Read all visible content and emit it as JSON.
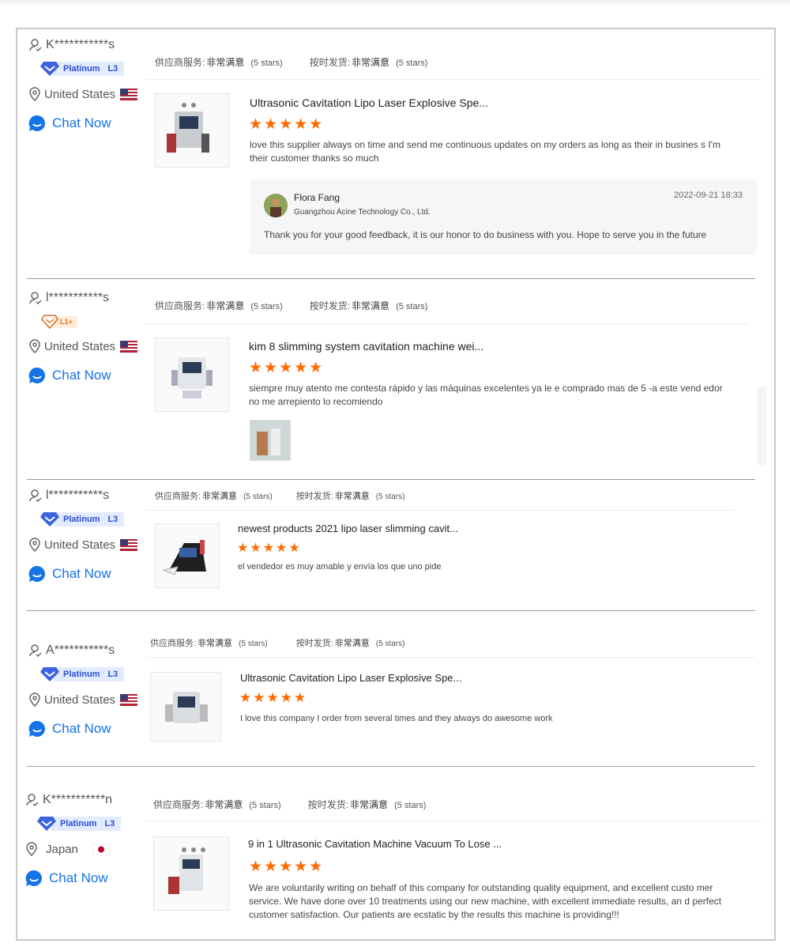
{
  "colors": {
    "accent_blue": "#1473e6",
    "star_orange": "#ff6a00",
    "platinum_badge": "#3d63e0",
    "l1_badge": "#e36a1a"
  },
  "labels": {
    "supplier_service": "供应商服务:",
    "on_time_delivery": "按时发货:",
    "rating_value": "非常满意",
    "stars_text": "(5 stars)",
    "chat_now": "Chat Now",
    "platinum": "Platinum",
    "level_l3": "L3",
    "level_l1": "L1+"
  },
  "reviews": [
    {
      "buyer": "K***********s",
      "badge": "platinum",
      "country": "United States",
      "flag": "us-flag",
      "product_title": "Ultrasonic Cavitation Lipo Laser Explosive Spe...",
      "stars": "★★★★★",
      "comment": "love this supplier always on time and send me continuous updates on my orders as long as their in busines s I'm their customer thanks so much",
      "reply": {
        "name": "Flora Fang",
        "company": "Guangzhou Acine Technology Co., Ltd.",
        "date": "2022-09-21 18:33",
        "text": "Thank you for your good feedback, it is our honor to do business with you. Hope to serve you in the future"
      }
    },
    {
      "buyer": "l***********s",
      "badge": "l1",
      "country": "United States",
      "flag": "us-flag",
      "product_title": "kim 8 slimming system cavitation machine wei...",
      "stars": "★★★★★",
      "comment": "siempre muy atento me contesta rápido y las máquinas excelentes ya le e comprado mas de 5 -a este vend edor no me arrepiento lo recomiendo"
    },
    {
      "buyer": "l***********s",
      "badge": "platinum",
      "country": "United States",
      "flag": "us-flag",
      "product_title": "newest products 2021 lipo laser slimming cavit...",
      "stars": "★★★★★",
      "comment": "el vendedor es muy amable y envía los que uno pide"
    },
    {
      "buyer": "A***********s",
      "badge": "platinum",
      "country": "United States",
      "flag": "us-flag",
      "product_title": "Ultrasonic Cavitation Lipo Laser Explosive Spe...",
      "stars": "★★★★★",
      "comment": "I love this company I order from several times and they always do awesome work"
    },
    {
      "buyer": "K***********n",
      "badge": "platinum",
      "country": "Japan",
      "flag": "japan-flag",
      "product_title": "9  in 1 Ultrasonic Cavitation Machine Vacuum To Lose ...",
      "stars": "★★★★★",
      "comment": "We are voluntarily writing on behalf of this company for outstanding quality equipment, and excellent custo mer service. We have done over 10 treatments using our new machine, with excellent immediate results, an d perfect customer satisfaction. Our patients are ecstatic by the results this machine is providing!!!"
    }
  ]
}
